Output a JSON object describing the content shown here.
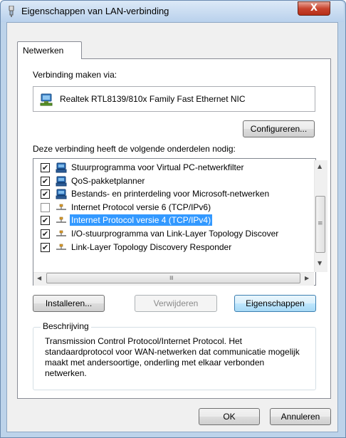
{
  "window": {
    "title": "Eigenschappen van LAN-verbinding",
    "close_label": "X"
  },
  "tabs": [
    {
      "label": "Netwerken",
      "active": true
    }
  ],
  "connect_via": {
    "label": "Verbinding maken via:",
    "adapter_name": "Realtek RTL8139/810x Family Fast Ethernet NIC",
    "adapter_icon": "network-adapter-icon",
    "configure_button": "Configureren..."
  },
  "components": {
    "label": "Deze verbinding heeft de volgende onderdelen nodig:",
    "items": [
      {
        "label": "Stuurprogramma voor Virtual PC-netwerkfilter",
        "checked": true,
        "icon": "client-icon",
        "selected": false
      },
      {
        "label": "QoS-pakketplanner",
        "checked": true,
        "icon": "client-icon",
        "selected": false
      },
      {
        "label": "Bestands- en printerdeling voor Microsoft-netwerken",
        "checked": true,
        "icon": "client-icon",
        "selected": false
      },
      {
        "label": "Internet Protocol versie 6 (TCP/IPv6)",
        "checked": false,
        "icon": "protocol-icon",
        "selected": false
      },
      {
        "label": "Internet Protocol versie 4 (TCP/IPv4)",
        "checked": true,
        "icon": "protocol-icon",
        "selected": true
      },
      {
        "label": "I/O-stuurprogramma van Link-Layer Topology Discover",
        "checked": true,
        "icon": "protocol-icon",
        "selected": false
      },
      {
        "label": "Link-Layer Topology Discovery Responder",
        "checked": true,
        "icon": "protocol-icon",
        "selected": false
      }
    ],
    "check_glyph": "✔"
  },
  "buttons": {
    "install": "Installeren...",
    "remove": "Verwijderen",
    "properties": "Eigenschappen",
    "ok": "OK",
    "cancel": "Annuleren"
  },
  "description": {
    "title": "Beschrijving",
    "text": "Transmission Control Protocol/Internet Protocol. Het standaardprotocol voor WAN-netwerken dat communicatie mogelijk maakt met andersoortige, onderling met elkaar verbonden netwerken."
  },
  "colors": {
    "selection": "#3399ff",
    "window_frame": "#bdd3ea"
  }
}
